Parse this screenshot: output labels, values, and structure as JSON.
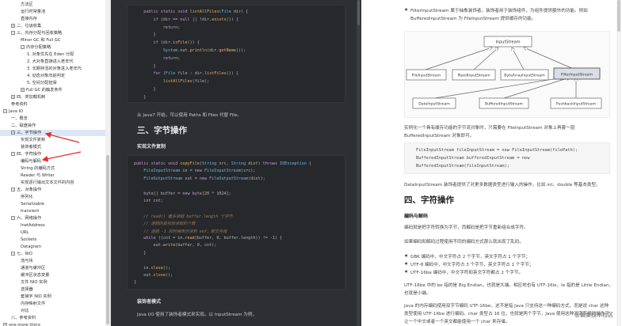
{
  "sidebar": {
    "items": [
      {
        "label": "方法区",
        "indent": 26,
        "toggle": ""
      },
      {
        "label": "运行时常量池",
        "indent": 26,
        "toggle": ""
      },
      {
        "label": "直接内存",
        "indent": 26,
        "toggle": ""
      },
      {
        "label": "二、垃圾收集",
        "indent": 14,
        "toggle": "+"
      },
      {
        "label": "三、内存分配与回收策略",
        "indent": 14,
        "toggle": "−"
      },
      {
        "label": "Minor GC 和 Full GC",
        "indent": 26,
        "toggle": ""
      },
      {
        "label": "内存分配策略",
        "indent": 26,
        "toggle": "−"
      },
      {
        "label": "1. 对象优先在 Eden 分配",
        "indent": 34,
        "toggle": ""
      },
      {
        "label": "2. 大对象直接进入老年代",
        "indent": 34,
        "toggle": ""
      },
      {
        "label": "3. 长期存活的对象进入老年代",
        "indent": 34,
        "toggle": ""
      },
      {
        "label": "4. 动态对象年龄判定",
        "indent": 34,
        "toggle": ""
      },
      {
        "label": "5. 空间分配担保",
        "indent": 34,
        "toggle": ""
      },
      {
        "label": "Full GC 的触发条件",
        "indent": 26,
        "toggle": "+"
      },
      {
        "label": "四、类加载机制",
        "indent": 14,
        "toggle": "+"
      },
      {
        "label": "参考资料",
        "indent": 14,
        "toggle": ""
      },
      {
        "label": "Java IO",
        "indent": 4,
        "toggle": "−"
      },
      {
        "label": "一、概览",
        "indent": 14,
        "toggle": ""
      },
      {
        "label": "二、磁盘操作",
        "indent": 14,
        "toggle": ""
      },
      {
        "label": "三、字节操作",
        "indent": 14,
        "toggle": "−",
        "highlight": true
      },
      {
        "label": "实现文件复制",
        "indent": 26,
        "toggle": ""
      },
      {
        "label": "装饰者模式",
        "indent": 26,
        "toggle": ""
      },
      {
        "label": "四、字符操作",
        "indent": 14,
        "toggle": "−"
      },
      {
        "label": "编码与解码",
        "indent": 26,
        "toggle": ""
      },
      {
        "label": "String 的编码方式",
        "indent": 26,
        "toggle": ""
      },
      {
        "label": "Reader 与 Writer",
        "indent": 26,
        "toggle": ""
      },
      {
        "label": "实现逐行输出文本文件的内容",
        "indent": 26,
        "toggle": ""
      },
      {
        "label": "五、对象操作",
        "indent": 14,
        "toggle": "−"
      },
      {
        "label": "序列化",
        "indent": 26,
        "toggle": ""
      },
      {
        "label": "Serializable",
        "indent": 26,
        "toggle": ""
      },
      {
        "label": "transient",
        "indent": 26,
        "toggle": ""
      },
      {
        "label": "六、网络操作",
        "indent": 14,
        "toggle": "−"
      },
      {
        "label": "InetAddress",
        "indent": 26,
        "toggle": ""
      },
      {
        "label": "URL",
        "indent": 26,
        "toggle": ""
      },
      {
        "label": "Sockets",
        "indent": 26,
        "toggle": ""
      },
      {
        "label": "Datagram",
        "indent": 26,
        "toggle": ""
      },
      {
        "label": "七、NIO",
        "indent": 14,
        "toggle": "−"
      },
      {
        "label": "流与块",
        "indent": 26,
        "toggle": ""
      },
      {
        "label": "通道与缓冲区",
        "indent": 26,
        "toggle": ""
      },
      {
        "label": "缓冲区状态变量",
        "indent": 26,
        "toggle": ""
      },
      {
        "label": "文件 NIO 实例",
        "indent": 26,
        "toggle": ""
      },
      {
        "label": "选择器",
        "indent": 26,
        "toggle": ""
      },
      {
        "label": "套接字 NIO 实例",
        "indent": 26,
        "toggle": ""
      },
      {
        "label": "内存映射文件",
        "indent": 26,
        "toggle": ""
      },
      {
        "label": "对比",
        "indent": 26,
        "toggle": ""
      },
      {
        "label": "八、参考资料",
        "indent": 14,
        "toggle": ""
      },
      {
        "label": "one more thing",
        "indent": 4,
        "toggle": "+"
      }
    ]
  },
  "dark": {
    "code1": [
      "    public static void listAllFiles(File dir) {",
      "        if (dir == null || !dir.exists()) {",
      "            return;",
      "        }",
      "        if (dir.isFile()) {",
      "            System.out.println(dir.getName());",
      "            return;",
      "        }",
      "        for (File file : dir.listFiles()) {",
      "            listAllFiles(file);",
      "        }",
      "    }"
    ],
    "after_code_text": "从 Java7 开始，可以使用 Paths 和 Files 代替 File。",
    "section3_title": "三、字节操作",
    "copy_title": "实现文件复制",
    "code2": [
      "public static void copyFile(String src, String dist) throws IOException {",
      "    FileInputStream in = new FileInputStream(src);",
      "    FileOutputStream out = new FileOutputStream(dist);",
      "",
      "    byte[] buffer = new byte[20 * 1024];",
      "    int cnt;",
      "",
      "    // read() 最多读取 buffer.length 个字节",
      "    // 返回的是实际读取的个数",
      "    // 返回 -1 的时候表示读到 eof，即文件尾",
      "    while ((cnt = in.read(buffer, 0, buffer.length)) != -1) {",
      "        out.write(buffer, 0, cnt);",
      "    }",
      "",
      "    in.close();",
      "    out.close();",
      "}"
    ],
    "decorator_title": "装饰者模式",
    "decorator_text": "Java I/O 使用了装饰者模式来实现。以 InputStream 为例，"
  },
  "light": {
    "bullet1_line1": "FilterInputStream 属于抽象装饰者，装饰者用于装饰组件，为组件提供额外的功能。例如",
    "bullet1_line2": "BufferedInputStream 为 FileInputStream 提供缓存的功能。",
    "diagram": {
      "root": "InputStream",
      "children": [
        "FileInputStream",
        "PipedInputStream",
        "ByteArrayInputStream",
        "FilterInputStream"
      ],
      "grandchildren": [
        "DataInputStream",
        "BufferedInputStream",
        "PushbackInputStream"
      ]
    },
    "para1_line1": "实例化一个具有缓存功能的字节流对象时，只需要在 FileInputStream 对象上再套一层",
    "para1_line2": "BufferedInputStream 对象即可。",
    "code": [
      "FileInputStream fileInputStream = new FileInputStream(filePath);",
      "BufferedInputStream bufferedInputStream = new",
      "BufferedInputStream(fileInputStream);"
    ],
    "para2": "DataInputStream 装饰者提供了对更多数据类型进行输入的操作，比如 int、double 等基本类型。",
    "section4_title": "四、字符操作",
    "encoding_title": "编码与解码",
    "para3": "编码就是把字符转换为字节，而解码是把字节重新组合成字符。",
    "para4": "如果编码和解码过程使用不同的编码方式那么就出现了乱码。",
    "bullets": [
      "GBK 编码中，中文字符占 2 个字节，英文字符占 1 个字节；",
      "UTF-8 编码中，中文字符占 3 个字节，英文字符占 1 个字节；",
      "UTF-16be 编码中，中文字符和英文字符都占 2 个字节。"
    ],
    "para5_line1": "UTF-16be 中的 be 指的是 Big Endian，也就是大端。相应地也有 UTF-16le，le 指的是 Little Endian，",
    "para5_line2": "也就是小端。",
    "para6_line1": "Java 的内存编码使用双字节编码 UTF-16be，这不是指 Java 只支持这一种编码方式，而是说 char 这种",
    "para6_line2": "类型使用 UTF-16be 进行编码。char 类型占 16 位，也就是两个字节，Java 使用这种双字节编码是为了",
    "para6_line3": "让一个中文或者一个英文都能使用一个 char 来存储。",
    "watermark": "@掘金技术社区"
  },
  "colors": {
    "dark_bg": "#2d2f33",
    "code_bg": "#26282b",
    "highlight": "#dce6f7",
    "arrow": "#e0302a"
  }
}
